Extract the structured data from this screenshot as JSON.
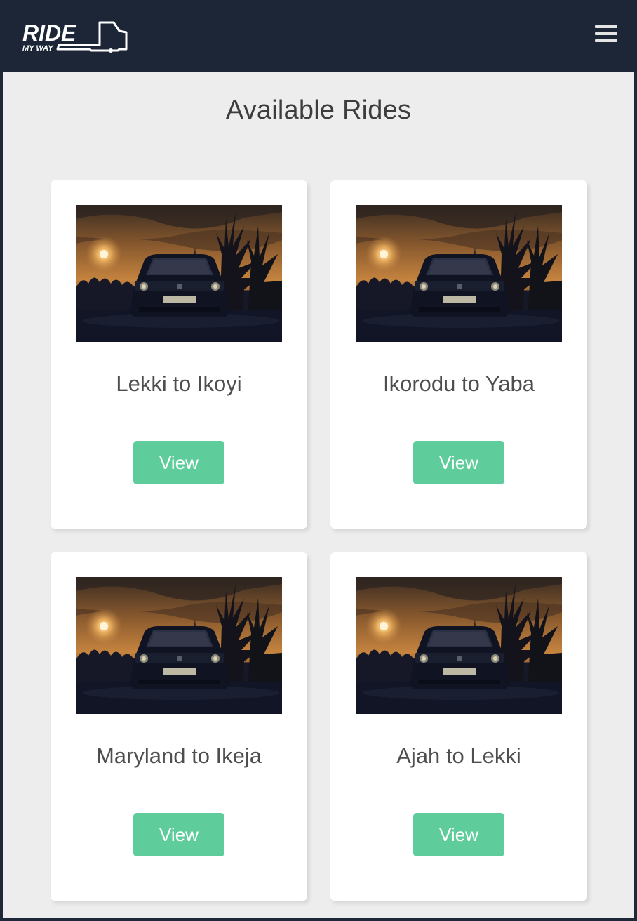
{
  "header": {
    "logo_text": "RIDE",
    "logo_tagline": "MY WAY",
    "menu_icon": "hamburger-menu-icon"
  },
  "page": {
    "title": "Available Rides"
  },
  "rides": [
    {
      "route": "Lekki to Ikoyi",
      "button_label": "View",
      "image_icon": "car-sunset-photo"
    },
    {
      "route": "Ikorodu to Yaba",
      "button_label": "View",
      "image_icon": "car-sunset-photo"
    },
    {
      "route": "Maryland to Ikeja",
      "button_label": "View",
      "image_icon": "car-sunset-photo"
    },
    {
      "route": "Ajah to Lekki",
      "button_label": "View",
      "image_icon": "car-sunset-photo"
    }
  ],
  "colors": {
    "navbar": "#1c2636",
    "background": "#ededed",
    "accent_button": "#5ecd9b",
    "card": "#ffffff"
  }
}
